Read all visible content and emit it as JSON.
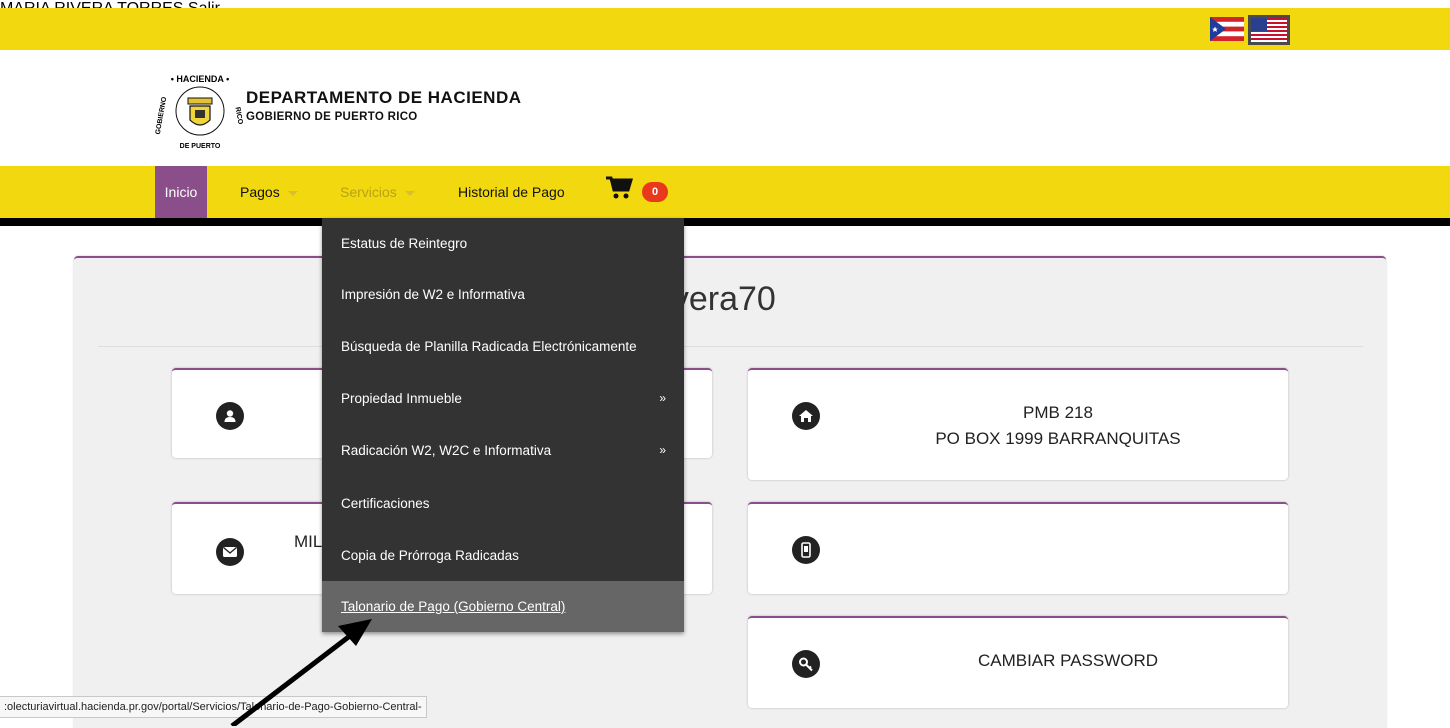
{
  "header": {
    "user_name": "MARIA RIVERA TORRES",
    "logout_label": "Salir",
    "dept_title": "DEPARTAMENTO DE HACIENDA",
    "dept_subtitle": "GOBIERNO DE PUERTO RICO",
    "logo_text_top": "HACIENDA",
    "logo_text_bottom": "GOBIERNO DE PUERTO RICO"
  },
  "nav": {
    "inicio": "Inicio",
    "pagos": "Pagos",
    "servicios": "Servicios",
    "historial": "Historial de Pago",
    "cart_count": "0"
  },
  "servicios_menu": [
    {
      "label": "Estatus de Reintegro",
      "submenu": false
    },
    {
      "label": "Impresión de W2 e Informativa",
      "submenu": false
    },
    {
      "label": "Búsqueda de Planilla Radicada Electrónicamente",
      "submenu": false
    },
    {
      "label": "Propiedad Inmueble",
      "submenu": true,
      "arrow": "»"
    },
    {
      "label": "Radicación W2, W2C e Informativa",
      "submenu": true,
      "arrow": "»"
    },
    {
      "label": "Certificaciones",
      "submenu": false
    },
    {
      "label": "Copia de Prórroga Radicadas",
      "submenu": false
    },
    {
      "label": "Talonario de Pago (Gobierno Central)",
      "submenu": false,
      "highlighted": true
    }
  ],
  "profile": {
    "username_partial": "rivera70",
    "email_partial": "MIL",
    "address_line1": "PMB 218",
    "address_line2": "PO BOX 1999 BARRANQUITAS",
    "change_password": "CAMBIAR PASSWORD"
  },
  "status_bar": {
    "url": ":olecturiavirtual.hacienda.pr.gov/portal/Servicios/Talonario-de-Pago-Gobierno-Central-"
  },
  "colors": {
    "yellow": "#f2d80f",
    "purple": "#8a4f8a",
    "menu_bg": "#333333",
    "menu_highlight": "#666666",
    "badge": "#e8391c"
  }
}
